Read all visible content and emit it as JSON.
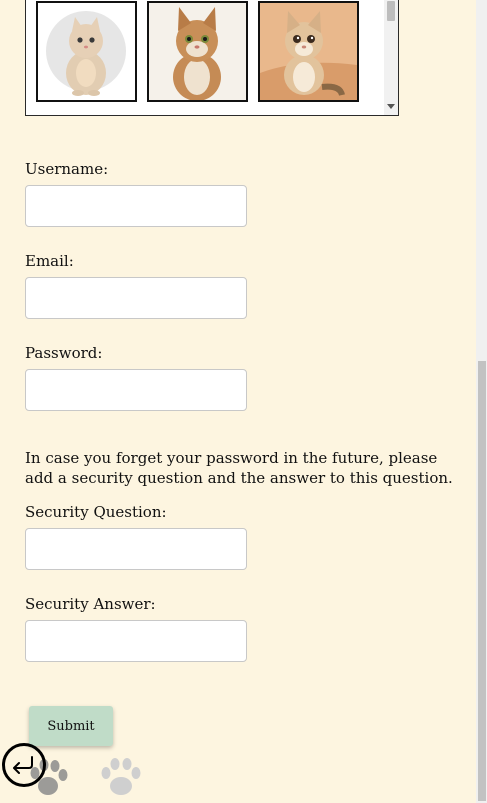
{
  "gallery": {
    "avatars": [
      {
        "name": "british-shorthair-cat",
        "bg": "#ececec"
      },
      {
        "name": "wild-cat",
        "bg": "#f3efe8"
      },
      {
        "name": "sand-cat",
        "bg": "#e9b88c"
      }
    ]
  },
  "form": {
    "username_label": "Username:",
    "email_label": "Email:",
    "password_label": "Password:",
    "security_note": "In case you forget your password in the future, please add a security question and the answer to this question.",
    "security_question_label": "Security Question:",
    "security_answer_label": "Security Answer:",
    "username_value": "",
    "email_value": "",
    "password_value": "",
    "security_question_value": "",
    "security_answer_value": "",
    "submit_label": "Submit"
  },
  "icons": {
    "back": "back-arrow-icon",
    "paw": "paw-print-icon"
  },
  "colors": {
    "background": "#fdf5e0",
    "submit": "#c0dcc8"
  }
}
